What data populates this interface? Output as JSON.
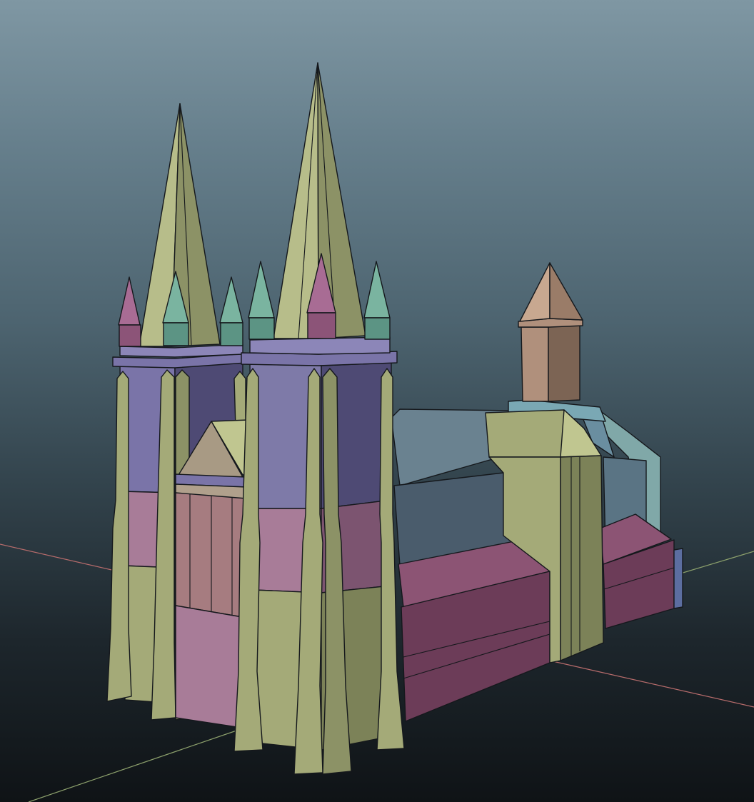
{
  "viewport": {
    "mode": "perspective",
    "shading": "flat-color-wireframe"
  },
  "scene": {
    "object": "gothic-cathedral-model",
    "colors": {
      "spire": "#b7bd8a",
      "spire_dark": "#8c9266",
      "tower_top": "#7a74a8",
      "tower_top_dark": "#4e4a74",
      "tower_mid": "#a87c98",
      "tower_mid_dark": "#7c5470",
      "tower_base": "#a4aa78",
      "tower_base_dark": "#7c8258",
      "pinnacle_pink": "#a86c94",
      "pinnacle_teal": "#7ab4a0",
      "nave_roof": "#6a8290",
      "nave_wall": "#4a5c6c",
      "nave_base": "#8c5474",
      "nave_base_dark": "#6c3c58",
      "transept": "#a4aa78",
      "transept_dark": "#6c7050",
      "crossing_tower": "#b0907c",
      "crossing_tower_dark": "#7c6454",
      "aisle_teal": "#80a8a8",
      "axis_x": "#b86c6c",
      "axis_z": "#8ca06c"
    }
  }
}
